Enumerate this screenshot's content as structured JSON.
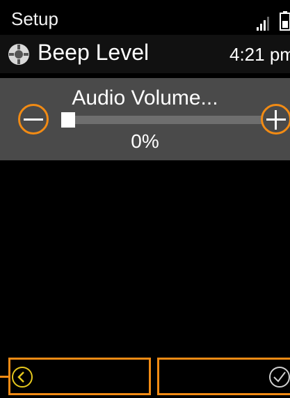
{
  "status_bar": {
    "app_label": "Setup",
    "signal_icon": "signal-bars-icon",
    "battery_icon": "battery-icon"
  },
  "title_bar": {
    "icon": "settings-gear-icon",
    "title": "Beep Level",
    "time": "4:21 pm"
  },
  "volume_control": {
    "label": "Audio Volume...",
    "value_text": "0%",
    "level": 0,
    "decrease_icon": "minus-icon",
    "increase_icon": "plus-icon"
  },
  "softkeys": {
    "left_icon": "back-chevron-icon",
    "right_icon": "checkmark-icon"
  },
  "colors": {
    "highlight": "#f28b14",
    "panel": "#4a4a4a",
    "background": "#000000"
  }
}
